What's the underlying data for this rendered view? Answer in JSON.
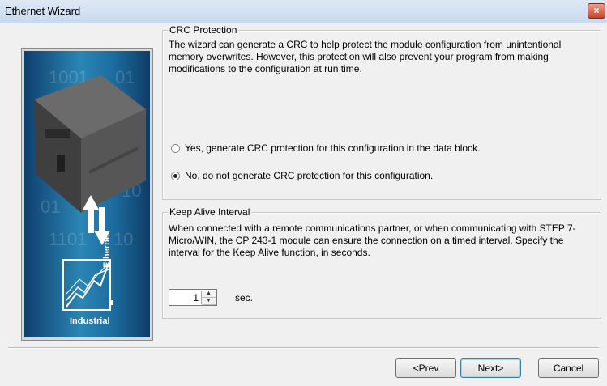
{
  "window": {
    "title": "Ethernet Wizard",
    "close_symbol": "×"
  },
  "image_panel": {
    "bits_rows": [
      "1001",
      "01",
      "1",
      "01",
      "10",
      "01",
      "1101",
      "10"
    ],
    "industrial_label": "Industrial",
    "ethernet_label": "Ethernet"
  },
  "crc": {
    "legend": "CRC Protection",
    "description": "The wizard can generate a CRC to help protect the module configuration from unintentional memory overwrites. However, this protection will also prevent your program from making modifications to the configuration at run time.",
    "option_yes": "Yes, generate CRC protection for this configuration in the data block.",
    "option_no": "No, do not generate CRC protection for this configuration.",
    "selected": "no"
  },
  "keepalive": {
    "legend": "Keep Alive Interval",
    "description": "When connected with a remote communications partner, or when communicating with STEP 7-Micro/WIN, the CP 243-1 module can ensure the connection on a timed interval. Specify the interval for the Keep Alive function, in seconds.",
    "value": "1",
    "unit": "sec."
  },
  "buttons": {
    "prev": "<Prev",
    "next": "Next>",
    "cancel": "Cancel"
  },
  "colors": {
    "accent": "#3c7fb1",
    "panel_blue": "#1d6da0"
  }
}
